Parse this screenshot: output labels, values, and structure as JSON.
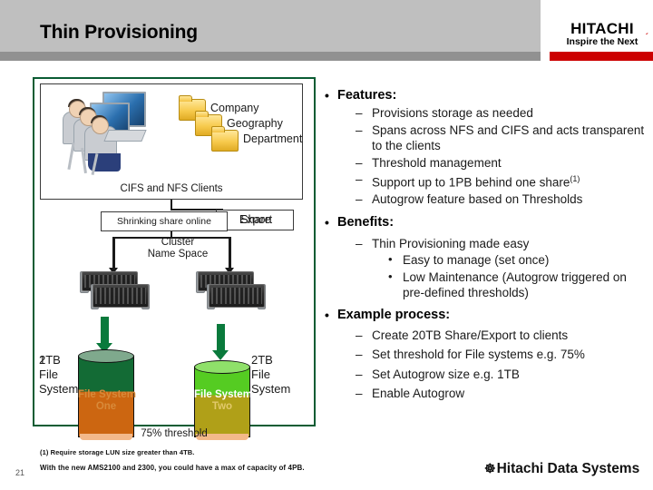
{
  "header": {
    "title": "Thin Provisioning",
    "logo_brand": "HITACHI",
    "logo_tagline": "Inspire the Next"
  },
  "diagram": {
    "clients_caption": "CIFS and NFS Clients",
    "folders": [
      {
        "label": "Company",
        "icon": "folder-icon"
      },
      {
        "label": "Geography",
        "icon": "folder-icon"
      },
      {
        "label": "Department",
        "icon": "folder-icon"
      }
    ],
    "share_label": "Share",
    "export_label": "Export",
    "shrink_label": "Shrinking share online",
    "cluster_name_space": "Cluster\nName Space",
    "cluster_name_space_line1": "Cluster",
    "cluster_name_space_line2": "Name Space",
    "left_capacity_overlap": "1",
    "left_capacity": "2TB",
    "left_capacity_line2": "File",
    "left_capacity_line3": "System",
    "right_capacity": "2TB",
    "right_capacity_line2": "File",
    "right_capacity_line3": "System",
    "cylinder_one_line1": "File System",
    "cylinder_one_line2": "One",
    "cylinder_two_line1": "File System",
    "cylinder_two_line2": "Two",
    "threshold_caption": "75% threshold",
    "colors": {
      "panel_border": "#0a5c33",
      "arrow_green": "#0a7a3c",
      "fs_one_free": "#136b35",
      "fs_one_used": "#cc6611",
      "fs_two_free": "#55cc22",
      "fs_two_used": "#b0a018",
      "folder_yellow": "#f7ca4d",
      "base_peach": "#f3b98a"
    }
  },
  "content": {
    "sections": [
      {
        "heading": "Features:",
        "items": [
          {
            "text": "Provisions storage as needed"
          },
          {
            "text": "Spans across NFS and CIFS and acts transparent to the clients"
          },
          {
            "text": "Threshold management"
          },
          {
            "text": "Support up to 1PB behind one share",
            "sup": "(1)"
          },
          {
            "text": "Autogrow feature based on Thresholds"
          }
        ]
      },
      {
        "heading": "Benefits:",
        "items": [
          {
            "text": "Thin Provisioning made easy",
            "subitems": [
              "Easy to manage (set once)",
              "Low Maintenance (Autogrow triggered on pre-defined thresholds)"
            ]
          }
        ]
      },
      {
        "heading": "Example process:",
        "items": [
          {
            "text": "Create 20TB Share/Export to clients"
          },
          {
            "text": "Set threshold for File systems e.g. 75%"
          },
          {
            "text": "Set Autogrow size e.g. 1TB"
          },
          {
            "text": "Enable Autogrow"
          }
        ]
      }
    ],
    "bullet_glyph": "•",
    "dash_glyph": "–"
  },
  "footer": {
    "footnote_1": "(1) Require storage LUN size greater than 4TB.",
    "footnote_2": "With the new AMS2100 and 2300, you could have a max of capacity of 4PB.",
    "page_number": "21",
    "company_logo": "Hitachi Data Systems",
    "company_mark": "☸"
  }
}
